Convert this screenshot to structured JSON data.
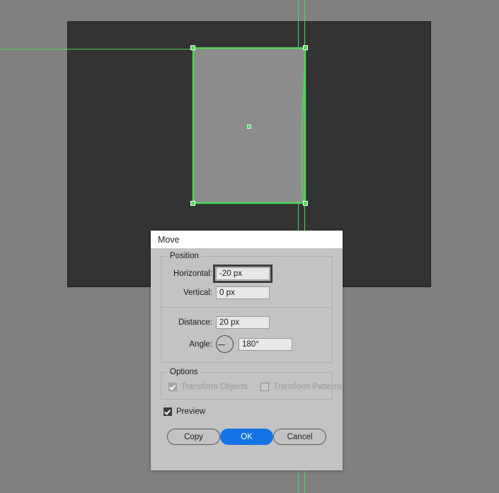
{
  "app": {
    "canvas": {
      "artboard_bg": "#333333",
      "workspace_bg": "#808080",
      "guide_color": "#4bdb54",
      "shape_fill": "#8c8c8c"
    }
  },
  "dialog": {
    "title": "Move",
    "position_group": {
      "legend": "Position",
      "fields": [
        {
          "label": "Horizontal:",
          "value": "-20 px",
          "focused": true
        },
        {
          "label": "Vertical:",
          "value": "0 px",
          "focused": false
        },
        {
          "label": "Distance:",
          "value": "20 px",
          "focused": false
        },
        {
          "label": "Angle:",
          "value": "180°",
          "focused": false
        }
      ]
    },
    "options_group": {
      "legend": "Options",
      "checkboxes": [
        {
          "label": "Transform Objects",
          "checked": true,
          "disabled": true
        },
        {
          "label": "Transform Patterns",
          "checked": false,
          "disabled": true
        }
      ]
    },
    "preview": {
      "label": "Preview",
      "checked": true
    },
    "buttons": [
      {
        "label": "Copy",
        "style": "secondary"
      },
      {
        "label": "OK",
        "style": "primary"
      },
      {
        "label": "Cancel",
        "style": "secondary"
      }
    ],
    "accent_color": "#1473e6"
  }
}
